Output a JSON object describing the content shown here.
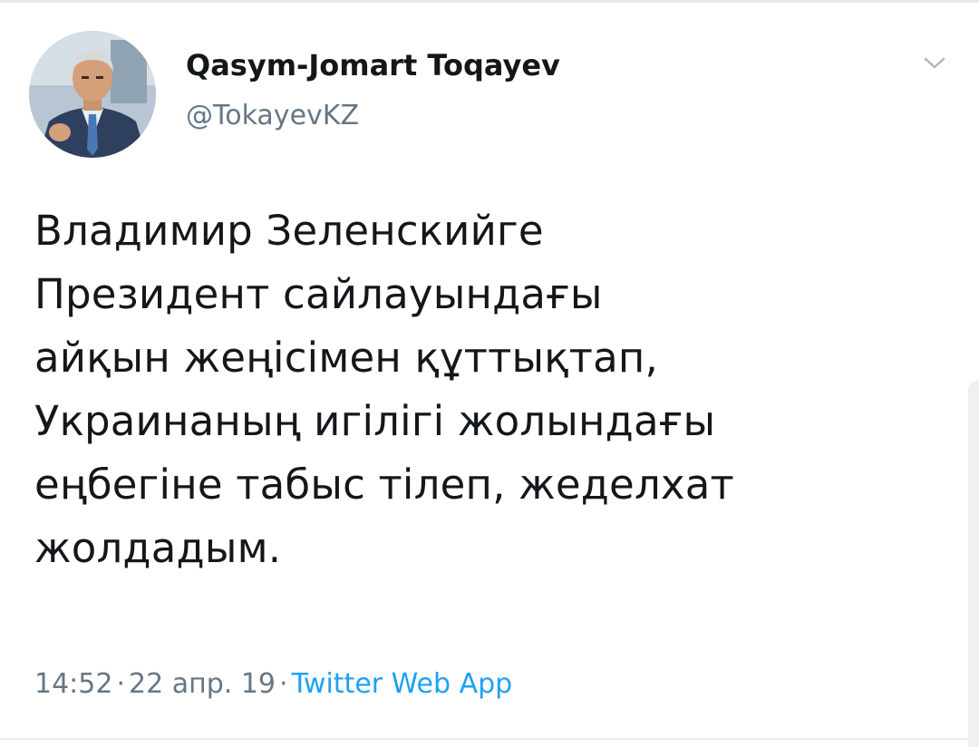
{
  "tweet": {
    "author": {
      "display_name": "Qasym-Jomart Toqayev",
      "handle": "@TokayevKZ"
    },
    "menu_icon": "chevron-down-icon",
    "text": "Владимир Зеленскийге\nПрезидент сайлауындағы\nайқын жеңісімен құттықтап,\nУкраинаның игілігі жолындағы\nеңбегіне табыс тілеп, жеделхат\nжолдадым.",
    "time": "14:52",
    "date": "22 апр. 19",
    "separator": "·",
    "source": "Twitter Web App"
  },
  "colors": {
    "text": "#14171a",
    "secondary": "#657786",
    "link": "#1da1f2",
    "divider": "#e6ecf0"
  }
}
